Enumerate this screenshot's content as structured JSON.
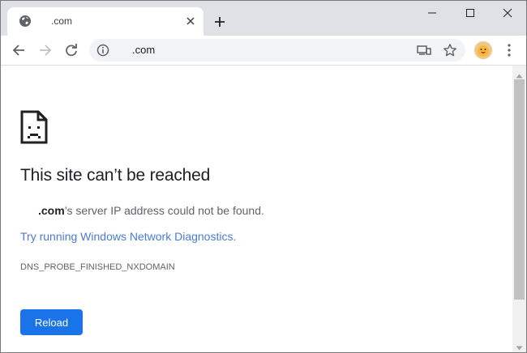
{
  "tab": {
    "title": ".com",
    "favicon_icon": "globe-icon",
    "close_icon": "close-icon"
  },
  "tabstrip": {
    "new_tab_icon": "plus-icon"
  },
  "window_controls": {
    "minimize_icon": "minimize-icon",
    "maximize_icon": "maximize-icon",
    "close_icon": "close-icon"
  },
  "toolbar": {
    "back_icon": "back-arrow-icon",
    "forward_icon": "forward-arrow-icon",
    "reload_icon": "reload-icon",
    "menu_icon": "kebab-menu-icon"
  },
  "omnibox": {
    "url": ".com",
    "site_info_icon": "info-icon",
    "cast_icon": "cast-icon",
    "bookmark_icon": "star-icon"
  },
  "error_page": {
    "icon": "sad-document-icon",
    "heading": "This site can’t be reached",
    "host": ".com",
    "message_suffix": "’s server IP address could not be found.",
    "diagnostics_link": "Try running Windows Network Diagnostics.",
    "error_code": "DNS_PROBE_FINISHED_NXDOMAIN",
    "reload_button": "Reload"
  },
  "colors": {
    "tabstrip_bg": "#dee1e6",
    "link": "#4a7ad3",
    "button": "#1a73e8",
    "text_primary": "#202124",
    "text_secondary": "#5f6368"
  }
}
